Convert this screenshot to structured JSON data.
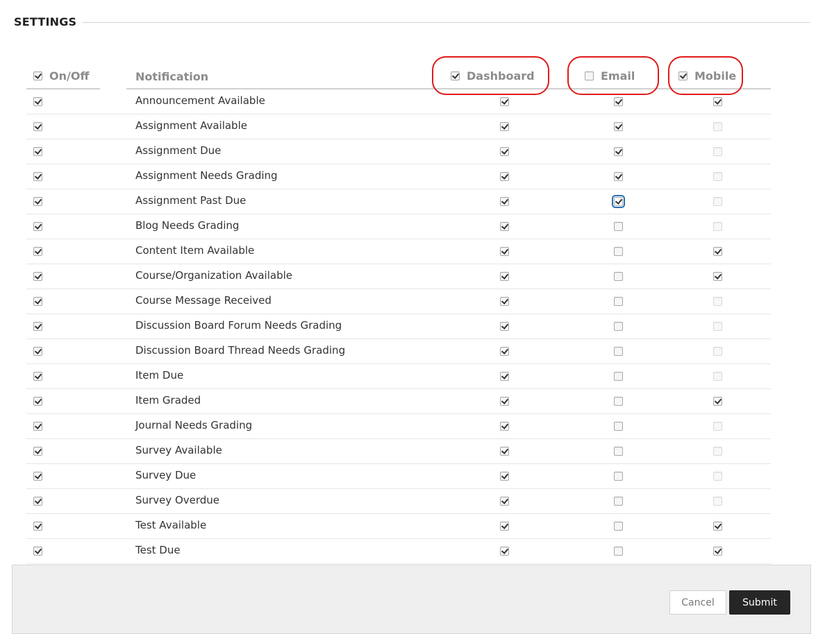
{
  "section": {
    "title": "SETTINGS"
  },
  "columns": {
    "onoff": {
      "label": "On/Off",
      "checked": true
    },
    "notification": {
      "label": "Notification"
    },
    "dashboard": {
      "label": "Dashboard",
      "checked": true
    },
    "email": {
      "label": "Email",
      "checked": false
    },
    "mobile": {
      "label": "Mobile",
      "checked": true
    }
  },
  "rows": [
    {
      "name": "Announcement Available",
      "onoff": true,
      "dashboard": true,
      "email": true,
      "mobile": "checked"
    },
    {
      "name": "Assignment Available",
      "onoff": true,
      "dashboard": true,
      "email": true,
      "mobile": "disabled"
    },
    {
      "name": "Assignment Due",
      "onoff": true,
      "dashboard": true,
      "email": true,
      "mobile": "disabled"
    },
    {
      "name": "Assignment Needs Grading",
      "onoff": true,
      "dashboard": true,
      "email": true,
      "mobile": "disabled"
    },
    {
      "name": "Assignment Past Due",
      "onoff": true,
      "dashboard": true,
      "email": true,
      "email_focused": true,
      "mobile": "disabled"
    },
    {
      "name": "Blog Needs Grading",
      "onoff": true,
      "dashboard": true,
      "email": false,
      "mobile": "disabled"
    },
    {
      "name": "Content Item Available",
      "onoff": true,
      "dashboard": true,
      "email": false,
      "mobile": "checked"
    },
    {
      "name": "Course/Organization Available",
      "onoff": true,
      "dashboard": true,
      "email": false,
      "mobile": "checked"
    },
    {
      "name": "Course Message Received",
      "onoff": true,
      "dashboard": true,
      "email": false,
      "mobile": "disabled"
    },
    {
      "name": "Discussion Board Forum Needs Grading",
      "onoff": true,
      "dashboard": true,
      "email": false,
      "mobile": "disabled"
    },
    {
      "name": "Discussion Board Thread Needs Grading",
      "onoff": true,
      "dashboard": true,
      "email": false,
      "mobile": "disabled"
    },
    {
      "name": "Item Due",
      "onoff": true,
      "dashboard": true,
      "email": false,
      "mobile": "disabled"
    },
    {
      "name": "Item Graded",
      "onoff": true,
      "dashboard": true,
      "email": false,
      "mobile": "checked"
    },
    {
      "name": "Journal Needs Grading",
      "onoff": true,
      "dashboard": true,
      "email": false,
      "mobile": "disabled"
    },
    {
      "name": "Survey Available",
      "onoff": true,
      "dashboard": true,
      "email": false,
      "mobile": "disabled"
    },
    {
      "name": "Survey Due",
      "onoff": true,
      "dashboard": true,
      "email": false,
      "mobile": "disabled"
    },
    {
      "name": "Survey Overdue",
      "onoff": true,
      "dashboard": true,
      "email": false,
      "mobile": "disabled"
    },
    {
      "name": "Test Available",
      "onoff": true,
      "dashboard": true,
      "email": false,
      "mobile": "checked"
    },
    {
      "name": "Test Due",
      "onoff": true,
      "dashboard": true,
      "email": false,
      "mobile": "checked"
    }
  ],
  "footer": {
    "cancel_label": "Cancel",
    "submit_label": "Submit"
  },
  "colors": {
    "highlight": "#e01a1a",
    "submit_bg": "#262626",
    "footer_bg": "#efefef",
    "focus": "#2a6fb8"
  }
}
